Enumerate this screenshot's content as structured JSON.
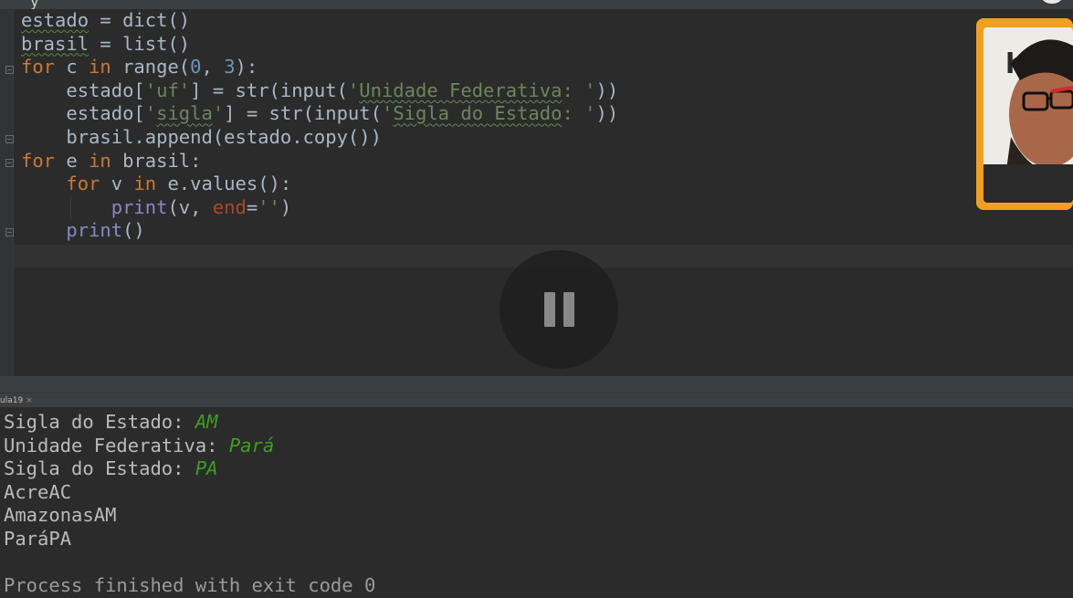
{
  "editor": {
    "lines": [
      {
        "t1": "estado",
        "t2": " = dict()"
      },
      {
        "t1": "brasil",
        "t2": " = list()"
      },
      {
        "kw1": "for",
        "t1": " c ",
        "kw2": "in",
        "t2": " range(",
        "n1": "0",
        "t3": ", ",
        "n2": "3",
        "t4": "):"
      },
      {
        "t1": "    estado[",
        "s1": "'uf'",
        "t2": "] = str(input(",
        "s2": "'",
        "s3": "Unidade Federativa",
        "s4": ": '",
        "t3": "))"
      },
      {
        "t1": "    estado[",
        "s1": "'",
        "s2": "sigla",
        "s3": "'",
        "t2": "] = str(input(",
        "s4": "'",
        "s5": "Sigla do Estado",
        "s6": ": '",
        "t3": "))"
      },
      {
        "t1": "    brasil.append(estado.copy())"
      },
      {
        "kw1": "for",
        "t1": " e ",
        "kw2": "in",
        "t2": " brasil:"
      },
      {
        "t1": "    ",
        "kw1": "for",
        "t2": " v ",
        "kw2": "in",
        "t3": " e.values():"
      },
      {
        "t1": "        ",
        "b1": "print",
        "t2": "(v, ",
        "p1": "end",
        "t3": "=",
        "s1": "''",
        "t4": ")"
      },
      {
        "t1": "    ",
        "b1": "print",
        "t2": "()"
      }
    ]
  },
  "run": {
    "tab_label": "ula19",
    "tab_close": "×",
    "output": [
      {
        "prompt": "Sigla do Estado: ",
        "input": "AM"
      },
      {
        "prompt": "Unidade Federativa: ",
        "input": "Pará"
      },
      {
        "prompt": "Sigla do Estado: ",
        "input": "PA"
      },
      {
        "text": "AcreAC"
      },
      {
        "text": "AmazonasAM"
      },
      {
        "text": "ParáPA"
      },
      {
        "text": ""
      },
      {
        "text": "Process finished with exit code 0"
      }
    ]
  },
  "topbar": {
    "glyph": "y"
  }
}
